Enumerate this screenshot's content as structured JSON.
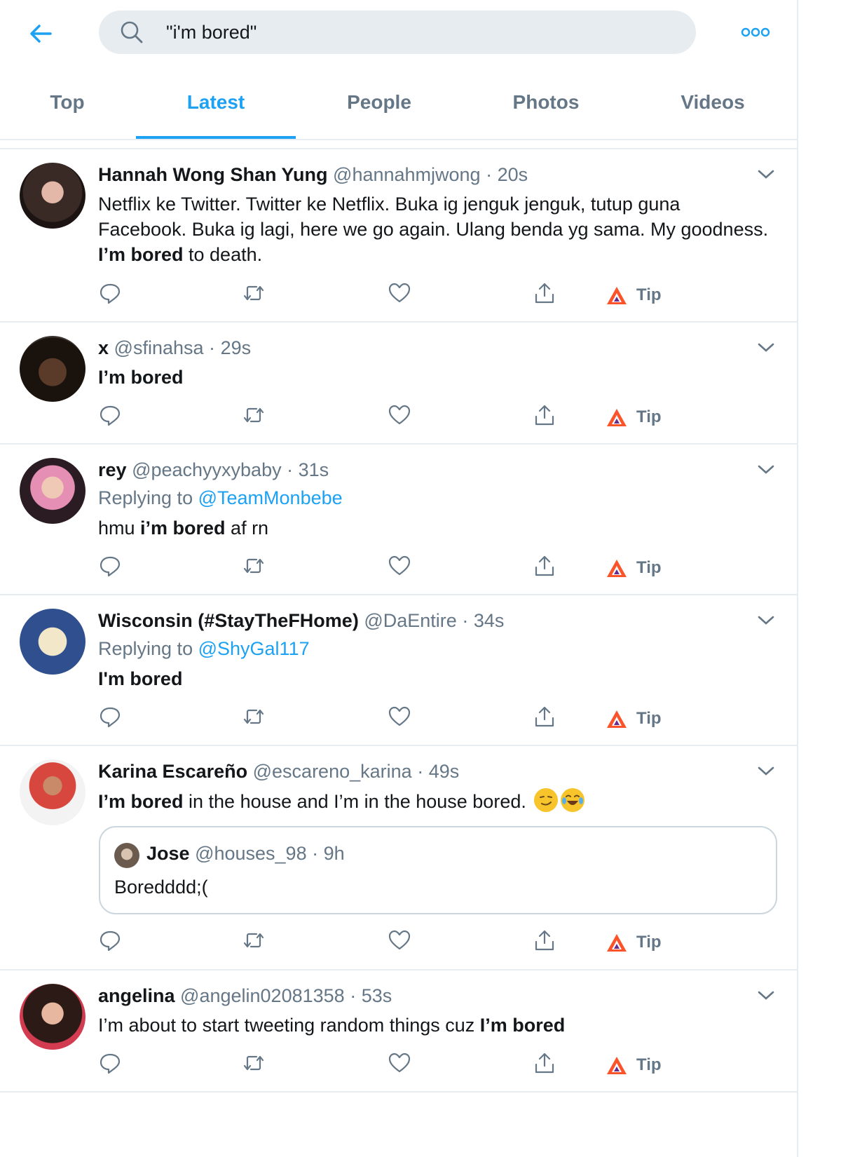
{
  "search": {
    "query": "\"i'm bored\""
  },
  "tabs": [
    {
      "label": "Top"
    },
    {
      "label": "Latest"
    },
    {
      "label": "People"
    },
    {
      "label": "Photos"
    },
    {
      "label": "Videos"
    }
  ],
  "active_tab": "Latest",
  "tip_label": "Tip",
  "reply_prefix": "Replying to",
  "tweets": [
    {
      "name": "Hannah Wong Shan Yung",
      "handle": "@hannahmjwong",
      "time": "20s",
      "line1": "Netflix ke Twitter. Twitter ke Netflix. Buka ig jenguk jenguk, tutup guna",
      "line2": "Facebook. Buka ig lagi, here we go again. Ulang benda yg sama. My goodness.",
      "bold": "I’m bored",
      "after": " to death."
    },
    {
      "name": "x",
      "handle": "@sfinahsa",
      "time": "29s",
      "bold": "I’m bored"
    },
    {
      "name": "rey",
      "handle": "@peachyyxybaby",
      "time": "31s",
      "reply_to": "@TeamMonbebe",
      "before": "hmu ",
      "bold": "i’m bored",
      "after": " af rn"
    },
    {
      "name": "Wisconsin (#StayTheFHome)",
      "handle": "@DaEntire",
      "time": "34s",
      "reply_to": "@ShyGal117",
      "bold": "I'm bored"
    },
    {
      "name": "Karina Escareño",
      "handle": "@escareno_karina",
      "time": "49s",
      "bold": "I’m bored",
      "after": " in the house and I’m in the house bored.",
      "emojis": [
        "smirking-face",
        "tears-of-joy"
      ],
      "quote": {
        "name": "Jose",
        "handle": "@houses_98",
        "time": "9h",
        "text": "Boredddd;("
      }
    },
    {
      "name": "angelina",
      "handle": "@angelin02081358",
      "time": "53s",
      "before": "I’m about to start tweeting random things cuz ",
      "bold": "I’m bored"
    }
  ],
  "colors": {
    "accent": "#1da1f2",
    "muted": "#657786",
    "border": "#e6ecf0",
    "text": "#14171a"
  }
}
